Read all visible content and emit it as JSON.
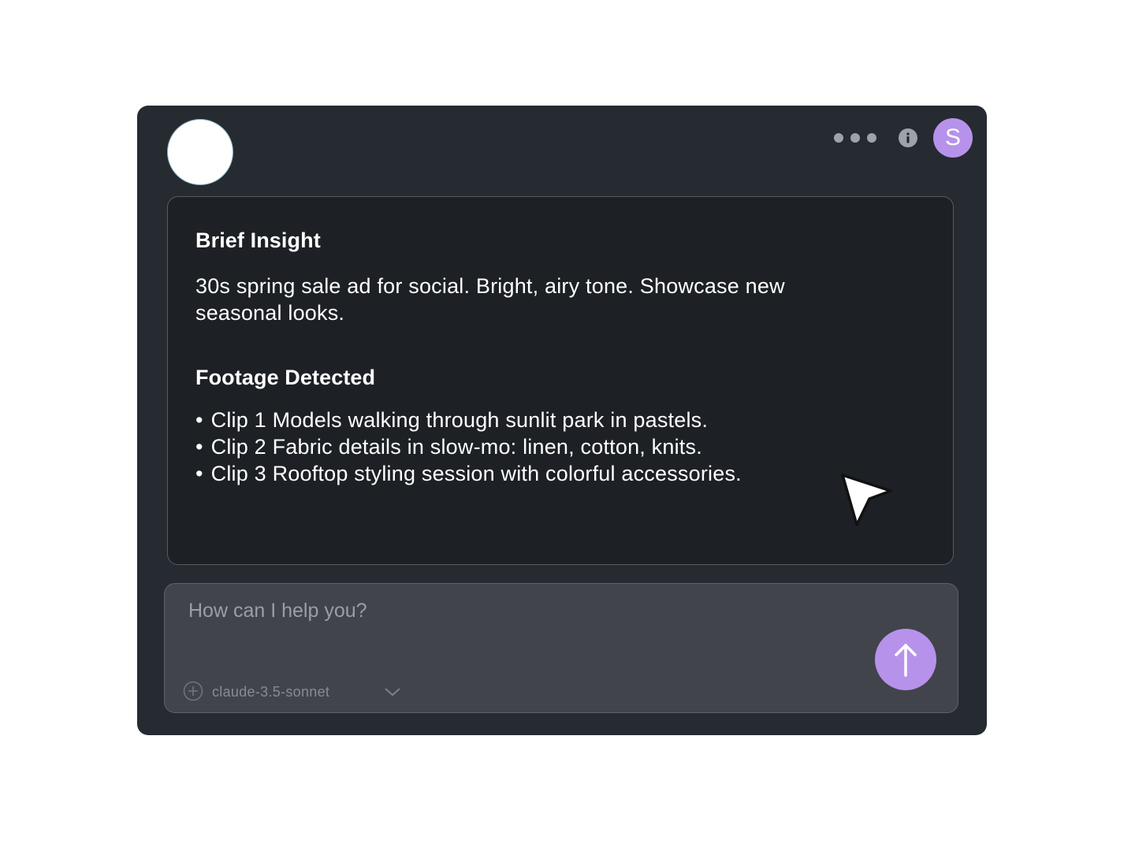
{
  "colors": {
    "page_background": "#ffffff",
    "window_background": "#262a31",
    "card_background": "#1d2025",
    "input_background": "#41444b",
    "accent": "#b792ea"
  },
  "header": {
    "avatar_initial": "S",
    "icons": [
      "more-dots-icon",
      "info-icon"
    ]
  },
  "brief": {
    "title": "Brief Insight",
    "body": "30s spring sale ad for social. Bright, airy tone. Showcase new seasonal looks."
  },
  "footage": {
    "title": "Footage Detected",
    "clips": [
      "Clip 1  Models walking through sunlit park in pastels.",
      "Clip 2 Fabric details in slow-mo: linen, cotton, knits.",
      "Clip 3 Rooftop styling session with colorful accessories."
    ]
  },
  "composer": {
    "placeholder": "How can I help you?",
    "value": "",
    "model": "claude-3.5-sonnet",
    "icons": [
      "plus-circle-icon",
      "chevron-down-icon",
      "arrow-up-icon"
    ]
  }
}
